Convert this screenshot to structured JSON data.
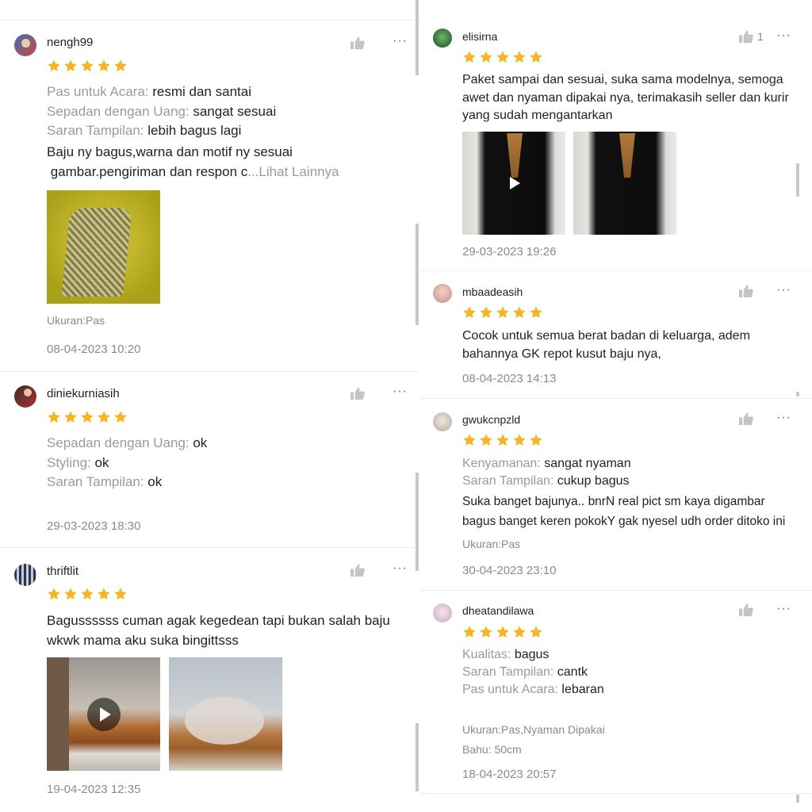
{
  "left_reviews": [
    {
      "username": "nengh99",
      "rating": 5,
      "attributes": [
        {
          "key": "Pas untuk Acara: ",
          "value": "resmi dan santai"
        },
        {
          "key": "Sepadan dengan Uang: ",
          "value": "sangat sesuai"
        },
        {
          "key": "Saran Tampilan: ",
          "value": "lebih bagus lagi"
        }
      ],
      "text_line1": "Baju ny bagus,warna dan motif ny sesuai",
      "text_line2": " gambar.pengiriman dan respon c",
      "see_more": "...Lihat Lainnya",
      "size_meta": "Ukuran:Pas",
      "date": "08-04-2023 10:20"
    },
    {
      "username": "diniekurniasih",
      "rating": 5,
      "attributes": [
        {
          "key": "Sepadan dengan Uang: ",
          "value": "ok"
        },
        {
          "key": "Styling: ",
          "value": "ok"
        },
        {
          "key": "Saran Tampilan: ",
          "value": "ok"
        }
      ],
      "date": "29-03-2023 18:30"
    },
    {
      "username": "thriftlit",
      "rating": 5,
      "text_line1": "Bagussssss cuman agak kegedean tapi bukan salah baju",
      "text_line2": "wkwk mama aku suka bingittsss",
      "date": "19-04-2023 12:35"
    }
  ],
  "right_reviews": [
    {
      "username": "elisirna",
      "like_count": "1",
      "rating": 5,
      "text_lines": [
        "Paket sampai dan sesuai, suka sama modelnya, semoga",
        "awet dan nyaman dipakai nya, terimakasih seller dan kurir",
        "yang sudah mengantarkan"
      ],
      "date": "29-03-2023 19:26"
    },
    {
      "username": "mbaadeasih",
      "rating": 5,
      "text_lines": [
        "Cocok untuk semua berat badan di keluarga, adem",
        "bahannya GK repot kusut baju nya,"
      ],
      "date": "08-04-2023 14:13"
    },
    {
      "username": "gwukcnpzld",
      "rating": 5,
      "attributes": [
        {
          "key": "Kenyamanan: ",
          "value": "sangat nyaman"
        },
        {
          "key": "Saran Tampilan: ",
          "value": "cukup bagus"
        }
      ],
      "text_lines": [
        "Suka banget bajunya.. bnrN real pict sm kaya digambar",
        "bagus banget keren pokokY gak nyesel udh order ditoko ini"
      ],
      "size_meta": "Ukuran:Pas",
      "date": "30-04-2023 23:10"
    },
    {
      "username": "dheatandilawa",
      "rating": 5,
      "attributes": [
        {
          "key": "Kualitas: ",
          "value": "bagus"
        },
        {
          "key": "Saran Tampilan: ",
          "value": "cantk"
        },
        {
          "key": "Pas untuk Acara: ",
          "value": "lebaran"
        }
      ],
      "size_meta": "Ukuran:Pas,Nyaman Dipakai",
      "shoulder_meta": "Bahu: 50cm",
      "date": "18-04-2023 20:57"
    }
  ],
  "icons": {
    "like": "thumbs-up-icon",
    "more": "more-options-icon",
    "star": "star-icon",
    "play": "play-icon"
  },
  "colors": {
    "star": "#f5b623",
    "label_grey": "#9a9a9a",
    "text": "#222222",
    "divider": "#ececec"
  }
}
